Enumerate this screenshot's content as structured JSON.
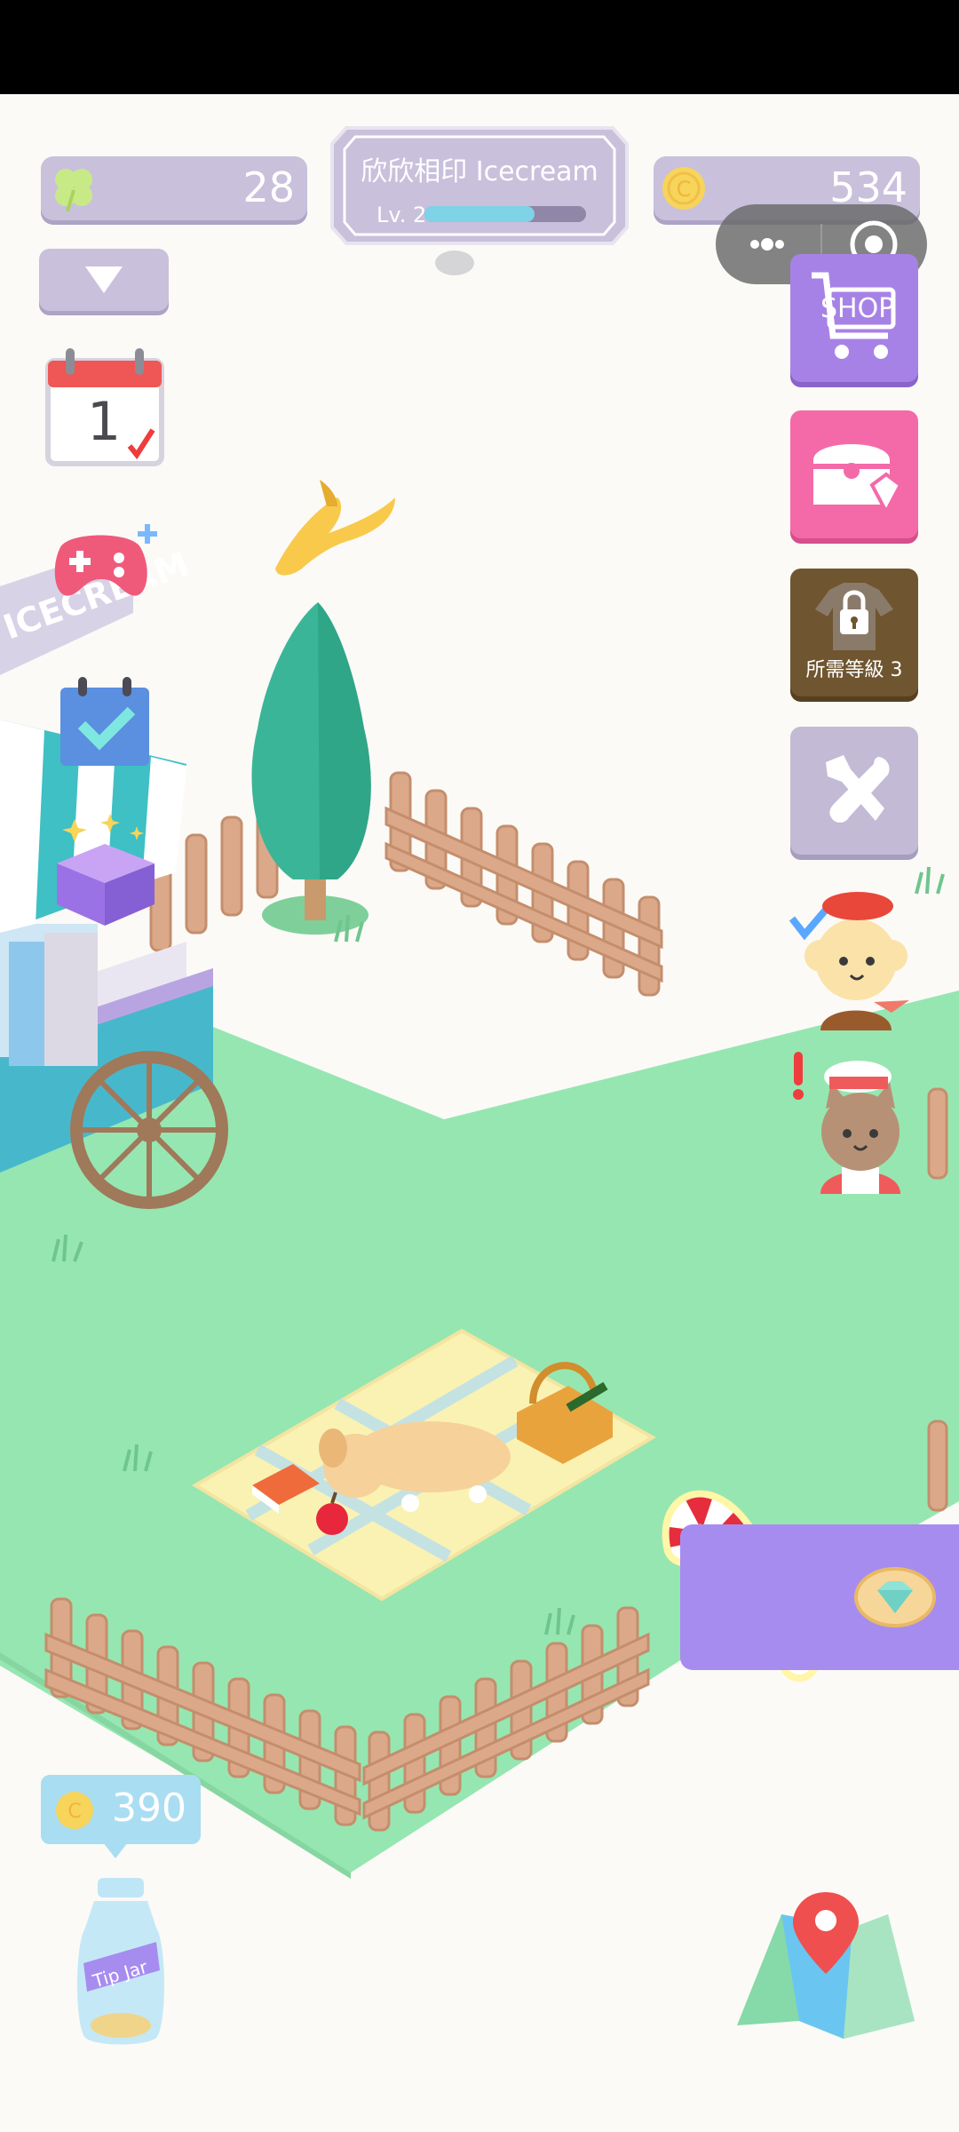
{
  "hud": {
    "clover_count": "28",
    "coin_count": "534",
    "shop_name": "欣欣相印 Icecream",
    "level_label": "Lv. 2",
    "xp_fraction": 0.68
  },
  "side_buttons": {
    "shop_label": "SHOP",
    "locked_label": "所需等級 3"
  },
  "calendar": {
    "day": "1"
  },
  "stand_sign": "ICECREAM",
  "tip_jar": {
    "amount": "390",
    "jar_label": "Tip Jar"
  },
  "colors": {
    "grass": "#96e6b1",
    "background": "#fbfaf6",
    "hud_purple": "#c9c0dc",
    "shop_purple": "#a782e6",
    "chest_pink": "#f46aa8",
    "xp_blue": "#7fd3e6"
  },
  "icons": [
    "clover-icon",
    "coin-icon",
    "dropdown-arrow-icon",
    "more-dots-icon",
    "target-icon",
    "shop-cart-icon",
    "chest-gem-icon",
    "locked-shirt-icon",
    "tools-icon",
    "calendar-icon",
    "gamepad-icon",
    "checklist-icon",
    "gift-box-icon",
    "diamond-icon",
    "map-pin-icon",
    "tip-jar-icon"
  ]
}
